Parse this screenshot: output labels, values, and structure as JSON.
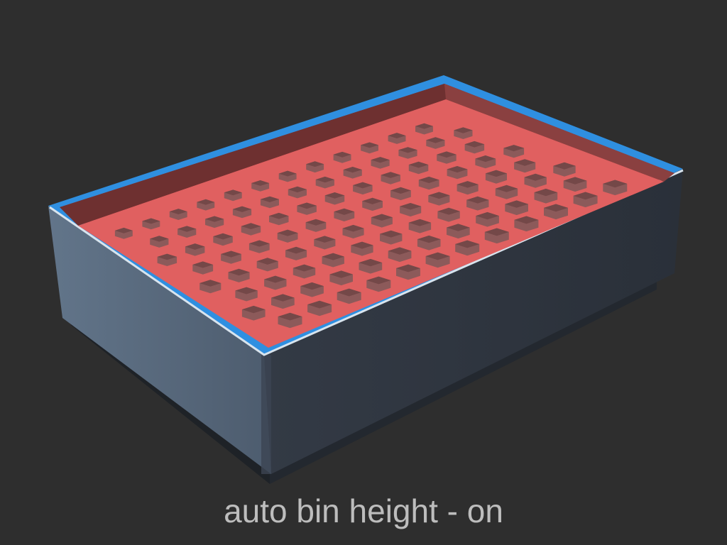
{
  "caption": "auto bin height - on",
  "model": {
    "object": "gridfinity-bin",
    "colors": {
      "background": "#2e2e2e",
      "wall_left": "#5a6b7f",
      "wall_front": "#2e3540",
      "base": "#1e2227",
      "rim": "#2f8fe0",
      "rim_highlight": "#d8e4ee",
      "interior_wall": "#a04848",
      "floor": "#e06060",
      "hex_pocket": "#8c5a5a",
      "hex_shadow": "#6a4040",
      "caption": "#bdbdbd"
    }
  }
}
